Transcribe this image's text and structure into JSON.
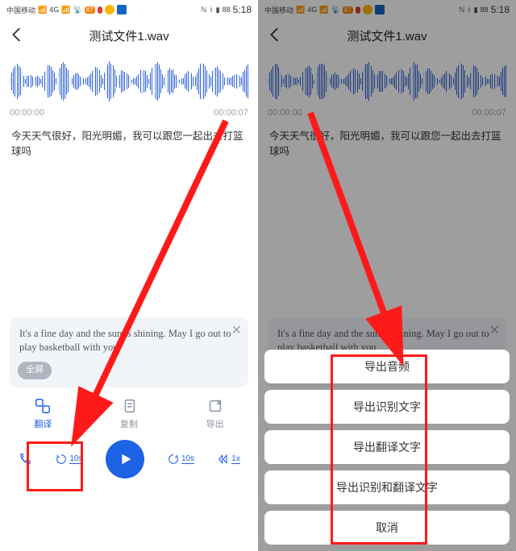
{
  "statusbar": {
    "carrier": "中国移动",
    "signal_text": "4G",
    "batt": "88",
    "time": "5:18"
  },
  "header": {
    "title": "测试文件1.wav"
  },
  "times": {
    "start": "00:00:00",
    "end": "00:00:07"
  },
  "transcript": "今天天气很好，阳光明媚，我可以跟您一起出去打篮球吗",
  "translation": "It's a fine day and the sun is shining. May I go out to play basketball with you",
  "fullscreen_label": "全屏",
  "tabs": {
    "translate": "翻译",
    "copy": "复制",
    "export": "导出"
  },
  "controls": {
    "back10": "10s",
    "fwd10": "10s",
    "speed": "1x"
  },
  "sheet": {
    "export_audio": "导出音频",
    "export_recognized": "导出识别文字",
    "export_translated": "导出翻译文字",
    "export_both": "导出识别和翻译文字",
    "cancel": "取消"
  }
}
